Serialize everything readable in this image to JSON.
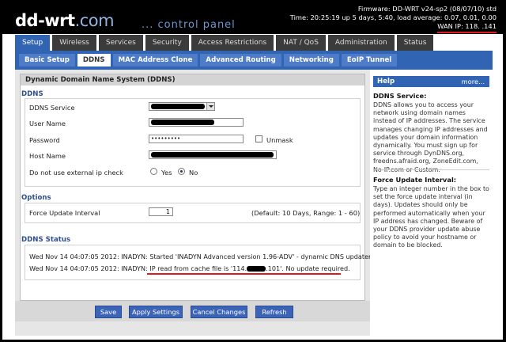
{
  "header": {
    "logo_main": "dd-wrt",
    "logo_dotcom": ".com",
    "subtitle": "... control panel",
    "firmware": "Firmware: DD-WRT v24-sp2 (08/07/10) std",
    "time": "Time: 20:25:19 up 5 days, 5:40, load average: 0.07, 0.01, 0.00",
    "wan_ip": "WAN IP: 118.                .141"
  },
  "main_tabs": [
    {
      "label": "Setup",
      "active": true
    },
    {
      "label": "Wireless"
    },
    {
      "label": "Services"
    },
    {
      "label": "Security"
    },
    {
      "label": "Access Restrictions"
    },
    {
      "label": "NAT / QoS"
    },
    {
      "label": "Administration"
    },
    {
      "label": "Status"
    }
  ],
  "sub_tabs": [
    {
      "label": "Basic Setup"
    },
    {
      "label": "DDNS",
      "active": true
    },
    {
      "label": "MAC Address Clone"
    },
    {
      "label": "Advanced Routing"
    },
    {
      "label": "Networking"
    },
    {
      "label": "EoIP Tunnel"
    }
  ],
  "panel": {
    "title": "Dynamic Domain Name System (DDNS)",
    "ddns_section": "DDNS",
    "ddns_service_label": "DDNS Service",
    "user_name_label": "User Name",
    "password_label": "Password",
    "password_value": "•••••••••",
    "unmask_label": "Unmask",
    "host_name_label": "Host Name",
    "no_ext_ip_label": "Do not use external ip check",
    "yes_label": "Yes",
    "no_label": "No",
    "options_section": "Options",
    "force_update_label": "Force Update Interval",
    "force_update_value": "1",
    "force_update_hint": "(Default: 10 Days, Range: 1 - 60)",
    "status_section": "DDNS Status",
    "log1": "Wed Nov 14 04:07:05 2012: INADYN: Started 'INADYN Advanced version 1.96-ADV' - dynamic DNS updater.",
    "log2_prefix": "Wed Nov 14 04:07:05 2012: INADYN: ",
    "log2_a": "IP read from cache file is '114.",
    "log2_b": ".101'. No update required."
  },
  "buttons": {
    "save": "Save",
    "apply": "Apply Settings",
    "cancel": "Cancel Changes",
    "refresh": "Refresh"
  },
  "help": {
    "title": "Help",
    "more": "more...",
    "h1": "DDNS Service:",
    "p1": "DDNS allows you to access your network using domain names instead of IP addresses. The service manages changing IP addresses and updates your domain information dynamically. You must sign up for service through DynDNS.org, freedns.afraid.org, ZoneEdit.com, No-IP.com or Custom.",
    "h2": "Force Update Interval:",
    "p2": "Type an integer number in the box to set the force update interval (in days). Updates should only be performed automatically when your IP address has changed. Beware of your DDNS provider update abuse policy to avoid your hostname or domain to be blocked."
  },
  "watermark": "#319683"
}
